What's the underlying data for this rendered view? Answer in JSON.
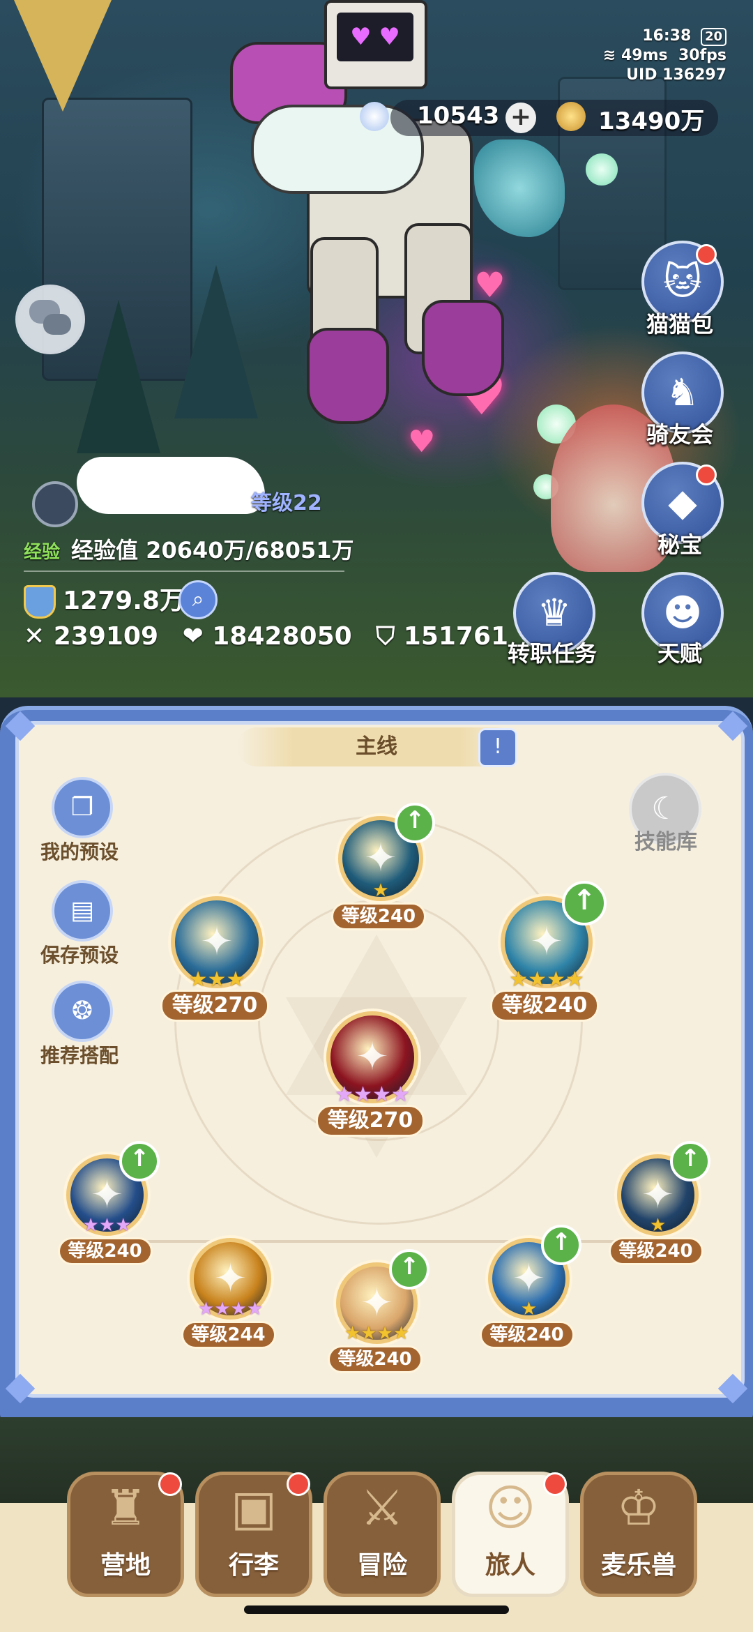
{
  "status": {
    "time": "16:38",
    "battery": "20",
    "ping": "49ms",
    "fps": "30fps",
    "uid_label": "UID",
    "uid": "136297"
  },
  "currency": {
    "stars": "10543",
    "coins": "13490万"
  },
  "side_menu": [
    {
      "label": "猫猫包",
      "icon": "cat-bag-icon",
      "badge": true
    },
    {
      "label": "骑友会",
      "icon": "horse-icon",
      "badge": false
    },
    {
      "label": "秘宝",
      "icon": "treasure-icon",
      "badge": true
    },
    {
      "label": "转职任务",
      "icon": "crown-icon",
      "badge": false
    },
    {
      "label": "天赋",
      "icon": "talent-head-icon",
      "badge": false
    }
  ],
  "player": {
    "level_text": "等级22",
    "exp_tag": "经验",
    "exp_label": "经验值",
    "exp_value": "20640万/68051万",
    "power": "1279.8万",
    "attack": "239109",
    "hp": "18428050",
    "defense": "151761"
  },
  "panel": {
    "tab_title": "主线",
    "left_buttons": [
      {
        "label": "我的预设",
        "icon": "preset-cards-icon"
      },
      {
        "label": "保存预设",
        "icon": "save-icon"
      },
      {
        "label": "推荐搭配",
        "icon": "recommend-icon"
      }
    ],
    "skill_library": "技能库",
    "skills": [
      {
        "id": "top",
        "level": "等级240",
        "stars": 1,
        "star_color": "gold",
        "upgrade": true,
        "color": "#1f5c7a"
      },
      {
        "id": "upper-left",
        "level": "等级270",
        "stars": 3,
        "star_color": "gold",
        "upgrade": false,
        "color": "#2a6c98"
      },
      {
        "id": "upper-right",
        "level": "等级240",
        "stars": 4,
        "star_color": "gold",
        "upgrade": true,
        "color": "#2f84a8"
      },
      {
        "id": "center",
        "level": "等级270",
        "stars": 4,
        "star_color": "purple",
        "upgrade": false,
        "color": "#8c1420"
      },
      {
        "id": "lower-far-left",
        "level": "等级240",
        "stars": 3,
        "star_color": "purple",
        "upgrade": true,
        "color": "#244e8a"
      },
      {
        "id": "lower-left",
        "level": "等级244",
        "stars": 4,
        "star_color": "purple",
        "upgrade": false,
        "color": "#c8821c"
      },
      {
        "id": "lower-center",
        "level": "等级240",
        "stars": 4,
        "star_color": "gold",
        "upgrade": true,
        "color": "#d9a56a"
      },
      {
        "id": "lower-right",
        "level": "等级240",
        "stars": 1,
        "star_color": "gold",
        "upgrade": true,
        "color": "#2d6fb0"
      },
      {
        "id": "lower-far-right",
        "level": "等级240",
        "stars": 1,
        "star_color": "gold",
        "upgrade": true,
        "color": "#22446a"
      }
    ]
  },
  "nav": [
    {
      "label": "营地",
      "icon": "castle-icon",
      "badge": true,
      "active": false
    },
    {
      "label": "行李",
      "icon": "backpack-icon",
      "badge": true,
      "active": false
    },
    {
      "label": "冒险",
      "icon": "crossed-swords-icon",
      "badge": false,
      "active": false
    },
    {
      "label": "旅人",
      "icon": "traveler-avatar-icon",
      "badge": true,
      "active": true
    },
    {
      "label": "麦乐兽",
      "icon": "pet-fox-icon",
      "badge": false,
      "active": false
    }
  ]
}
